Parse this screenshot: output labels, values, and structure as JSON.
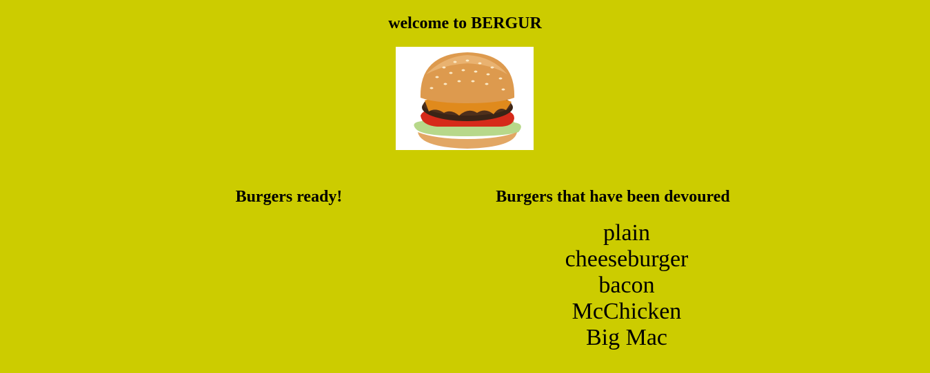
{
  "header": {
    "title": "welcome to BERGUR"
  },
  "hero": {
    "image": "burger-photo"
  },
  "ready": {
    "heading": "Burgers ready!",
    "items": []
  },
  "devoured": {
    "heading": "Burgers that have been devoured",
    "items": [
      "plain",
      "cheeseburger",
      "bacon",
      "McChicken",
      "Big Mac"
    ]
  },
  "colors": {
    "background": "#cccc00",
    "text": "#000000"
  }
}
